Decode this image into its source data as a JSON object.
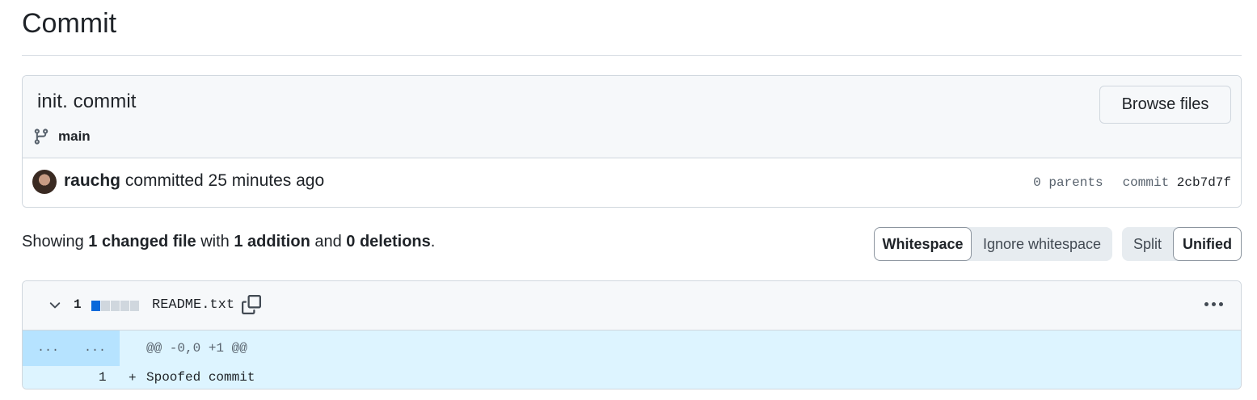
{
  "page": {
    "title": "Commit"
  },
  "commit": {
    "message": "init. commit",
    "branch": "main",
    "browse_label": "Browse files",
    "author": "rauchg",
    "action": " committed 25 minutes ago",
    "parents": "0 parents",
    "commit_label": "commit",
    "sha": "2cb7d7f"
  },
  "summary": {
    "prefix": "Showing ",
    "changed": "1 changed file",
    "with": " with ",
    "additions": "1 addition",
    "and": " and ",
    "deletions": "0 deletions",
    "suffix": "."
  },
  "toggles": {
    "whitespace": "Whitespace",
    "ignore_whitespace": "Ignore whitespace",
    "split": "Split",
    "unified": "Unified",
    "whitespace_selected": "Whitespace",
    "view_selected": "Unified"
  },
  "file": {
    "change_count": "1",
    "name": "README.txt",
    "diffstat": {
      "additions": 1,
      "deletions": 0,
      "blocks": 5
    },
    "hunk": {
      "old_marker": "...",
      "new_marker": "...",
      "header": "@@ -0,0 +1 @@"
    },
    "lines": [
      {
        "new_number": "1",
        "sign": "+",
        "text": "Spoofed commit"
      }
    ]
  },
  "colors": {
    "accent": "#0969da",
    "hunk_bg": "#ddf4ff",
    "hunk_gutter": "#b6e3ff",
    "border": "#d0d7de"
  },
  "icons": [
    "git-branch-icon",
    "chevron-down-icon",
    "copy-icon",
    "kebab-horizontal-icon"
  ]
}
